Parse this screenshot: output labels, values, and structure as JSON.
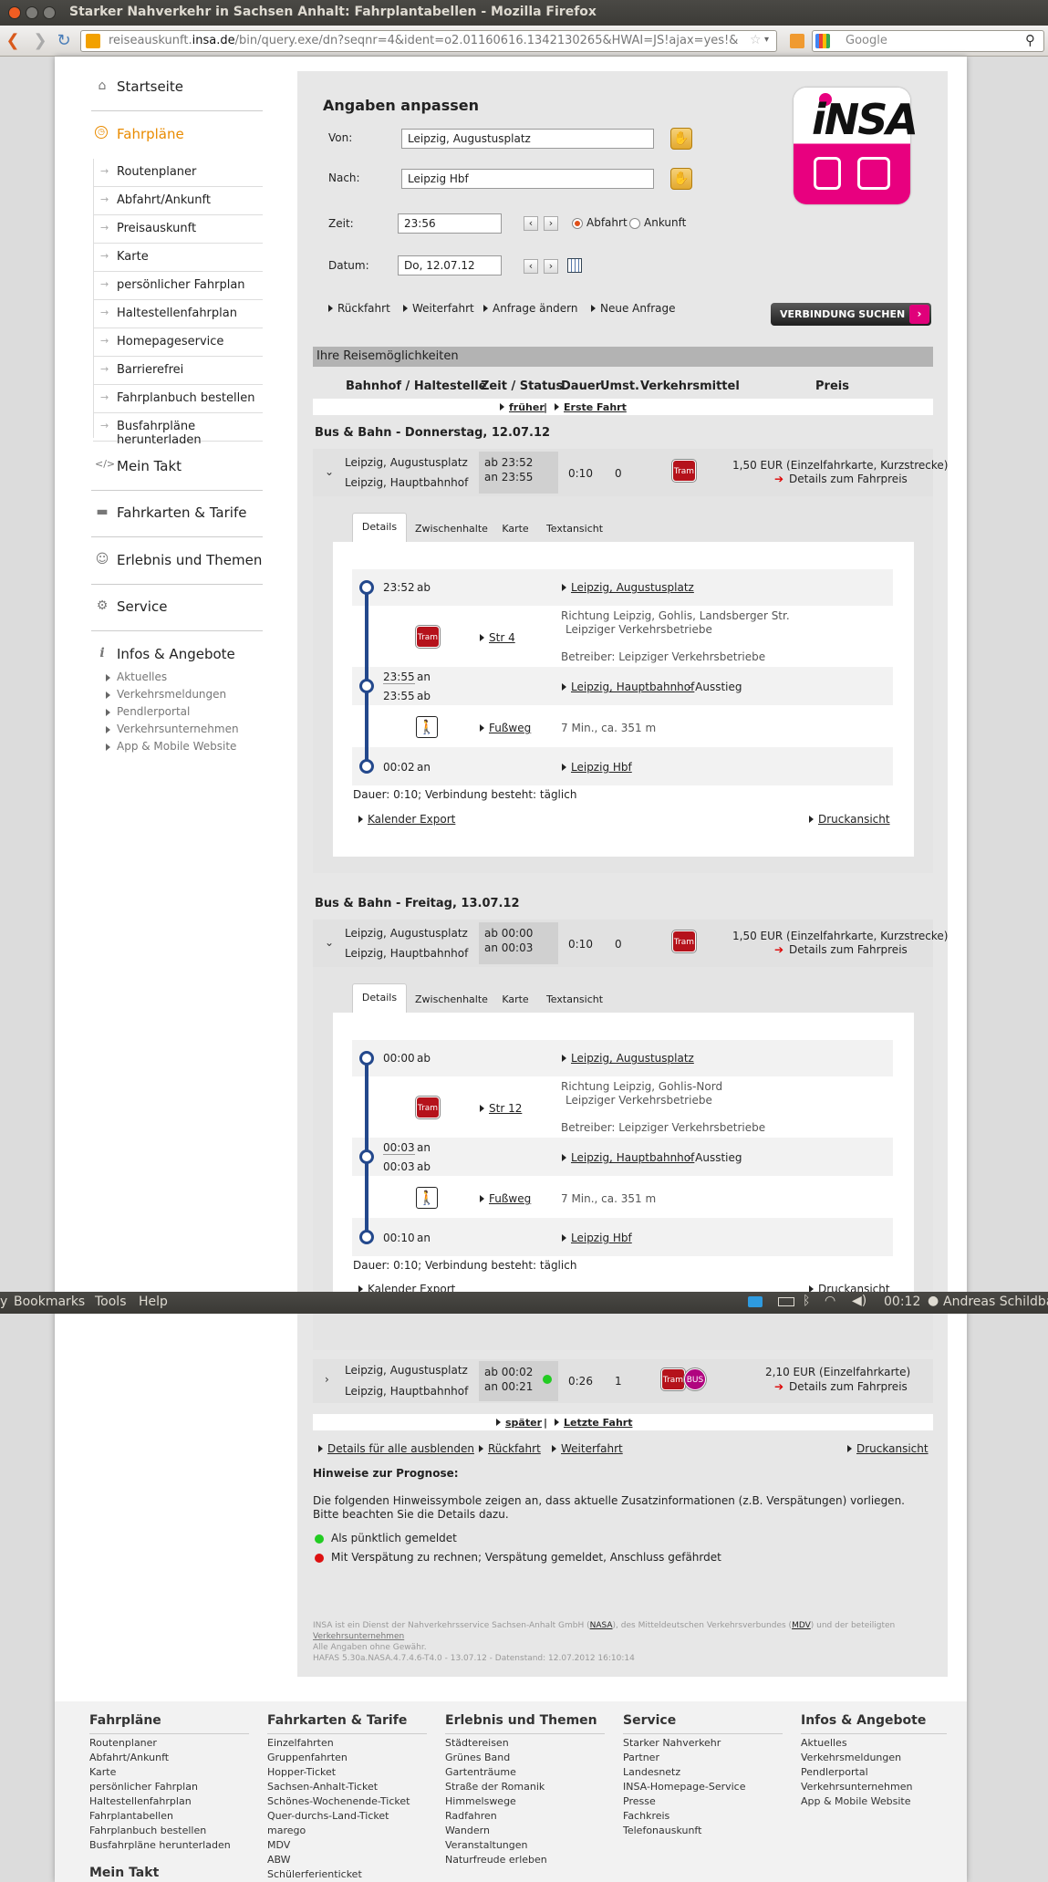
{
  "window": {
    "title": "Starker Nahverkehr in Sachsen Anhalt: Fahrplantabellen - Mozilla Firefox"
  },
  "browser": {
    "url_pre": "reiseauskunft.",
    "url_domain": "insa.de",
    "url_rest": "/bin/query.exe/dn?seqnr=4&ident=o2.01160616.1342130265&HWAI=JS!ajax=yes!&",
    "search_placeholder": "Google"
  },
  "sidebar": {
    "home": "Startseite",
    "fahrplaene": "Fahrpläne",
    "sub": [
      "Routenplaner",
      "Abfahrt/Ankunft",
      "Preisauskunft",
      "Karte",
      "persönlicher Fahrplan",
      "Haltestellenfahrplan",
      "Homepageservice",
      "Barrierefrei",
      "Fahrplanbuch bestellen",
      "Busfahrpläne herunterladen"
    ],
    "mein_takt": "Mein Takt",
    "tarife": "Fahrkarten & Tarife",
    "erlebnis": "Erlebnis und Themen",
    "service": "Service",
    "infos": "Infos & Angebote",
    "infos_sub": [
      "Aktuelles",
      "Verkehrsmeldungen",
      "Pendlerportal",
      "Verkehrsunternehmen",
      "App & Mobile Website"
    ]
  },
  "form": {
    "title": "Angaben anpassen",
    "von_label": "Von:",
    "von_value": "Leipzig, Augustusplatz",
    "nach_label": "Nach:",
    "nach_value": "Leipzig Hbf",
    "zeit_label": "Zeit:",
    "zeit_value": "23:56",
    "datum_label": "Datum:",
    "datum_value": "Do, 12.07.12",
    "abfahrt": "Abfahrt",
    "ankunft": "Ankunft",
    "links": [
      "Rückfahrt",
      "Weiterfahrt",
      "Anfrage ändern",
      "Neue Anfrage"
    ],
    "search_button": "VERBINDUNG SUCHEN"
  },
  "results": {
    "header": "Ihre Reisemöglichkeiten",
    "columns": [
      "Bahnhof / Haltestelle",
      "Zeit / Status",
      "Dauer",
      "Umst.",
      "Verkehrsmittel",
      "Preis"
    ],
    "earlier": "früher",
    "first": "Erste Fahrt",
    "sep": "|",
    "later": "später",
    "last": "Letzte Fahrt",
    "day1": "Bus & Bahn - Donnerstag, 12.07.12",
    "day2": "Bus & Bahn - Freitag, 13.07.12",
    "con1": {
      "from": "Leipzig, Augustusplatz",
      "to": "Leipzig, Hauptbahnhof",
      "dep": "ab 23:52",
      "arr": "an 23:55",
      "dur": "0:10",
      "changes": "0",
      "price": "1,50 EUR (Einzelfahrkarte, Kurzstrecke)",
      "price_link": "Details zum Fahrpreis"
    },
    "con2": {
      "from": "Leipzig, Augustusplatz",
      "to": "Leipzig, Hauptbahnhof",
      "dep": "ab 00:00",
      "arr": "an 00:03",
      "dur": "0:10",
      "changes": "0",
      "price": "1,50 EUR (Einzelfahrkarte, Kurzstrecke)",
      "price_link": "Details zum Fahrpreis"
    },
    "con3": {
      "from": "Leipzig, Augustusplatz",
      "to": "Leipzig, Hauptbahnhof",
      "dep": "ab 00:02",
      "arr": "an 00:21",
      "dur": "0:26",
      "changes": "1",
      "price": "2,10 EUR (Einzelfahrkarte)",
      "price_link": "Details zum Fahrpreis"
    },
    "tabs": [
      "Details",
      "Zwischenhalte",
      "Karte",
      "Textansicht"
    ],
    "tram": "Tram",
    "bus": "BUS",
    "d1": {
      "t1": "23:52",
      "ab": "ab",
      "an": "an",
      "s1": "Leipzig, Augustusplatz",
      "line": "Str 4",
      "dir": "Richtung Leipzig, Gohlis, Landsberger Str.",
      "op": "Leipziger Verkehrsbetriebe",
      "betr": "Betreiber: Leipziger Verkehrsbetriebe",
      "t2a": "23:55",
      "t2b": "23:55",
      "s2": "Leipzig, Hauptbahnhof",
      "aus": "- Ausstieg",
      "walk": "Fußweg",
      "walkinfo": "7 Min., ca. 351 m",
      "t3": "00:02",
      "s3": "Leipzig Hbf",
      "summary": "Dauer: 0:10; Verbindung besteht: täglich",
      "kal": "Kalender Export",
      "druck": "Druckansicht"
    },
    "d2": {
      "t1": "00:00",
      "ab": "ab",
      "an": "an",
      "s1": "Leipzig, Augustusplatz",
      "line": "Str 12",
      "dir": "Richtung Leipzig, Gohlis-Nord",
      "op": "Leipziger Verkehrsbetriebe",
      "betr": "Betreiber: Leipziger Verkehrsbetriebe",
      "t2a": "00:03",
      "t2b": "00:03",
      "s2": "Leipzig, Hauptbahnhof",
      "aus": "- Ausstieg",
      "walk": "Fußweg",
      "walkinfo": "7 Min., ca. 351 m",
      "t3": "00:10",
      "s3": "Leipzig Hbf",
      "summary": "Dauer: 0:10; Verbindung besteht: täglich",
      "kal": "Kalender Export",
      "druck": "Druckansicht"
    },
    "bottom_links": [
      "Details für alle ausblenden",
      "Rückfahrt",
      "Weiterfahrt",
      "Druckansicht"
    ],
    "hint_title": "Hinweise zur Prognose:",
    "hint_text1": "Die folgenden Hinweissymbole zeigen an, dass aktuelle Zusatzinformationen (z.B. Verspätungen) vorliegen.",
    "hint_text2": "Bitte beachten Sie die Details dazu.",
    "legend_green": "Als pünktlich gemeldet",
    "legend_red": "Mit Verspätung zu rechnen; Verspätung gemeldet, Anschluss gefährdet",
    "green": "#22cc22",
    "red": "#dd1111",
    "small1a": "INSA ist ein Dienst der Nahverkehrsservice Sachsen-Anhalt GmbH (",
    "nasa": "NASA",
    "small1b": "), des Mitteldeutschen Verkehrsverbundes (",
    "mdv": "MDV",
    "small1c": ") und der beteiligten",
    "small2": "Verkehrsunternehmen",
    "small3": "Alle Angaben ohne Gewähr.",
    "small4": "HAFAS 5.30a.NASA.4.7.4.6-T4.0 - 13.07.12 - Datenstand: 12.07.2012 16:10:14"
  },
  "ubuntu": {
    "menus": [
      "y",
      "Bookmarks",
      "Tools",
      "Help"
    ],
    "clock": "00:12",
    "user": "Andreas Schildba"
  },
  "footer": {
    "cols": [
      {
        "title": "Fahrpläne",
        "items": [
          "Routenplaner",
          "Abfahrt/Ankunft",
          "Karte",
          "persönlicher Fahrplan",
          "Haltestellenfahrplan",
          "Fahrplantabellen",
          "Fahrplanbuch bestellen",
          "Busfahrpläne herunterladen"
        ]
      },
      {
        "title": "Fahrkarten & Tarife",
        "items": [
          "Einzelfahrten",
          "Gruppenfahrten",
          "Hopper-Ticket",
          "Sachsen-Anhalt-Ticket",
          "Schönes-Wochenende-Ticket",
          "Quer-durchs-Land-Ticket",
          "marego",
          "MDV",
          "ABW",
          "Schülerferienticket"
        ]
      },
      {
        "title": "Erlebnis und Themen",
        "items": [
          "Städtereisen",
          "Grünes Band",
          "Gartenträume",
          "Straße der Romanik",
          "Himmelswege",
          "Radfahren",
          "Wandern",
          "Veranstaltungen",
          "Naturfreude erleben"
        ]
      },
      {
        "title": "Service",
        "items": [
          "Starker Nahverkehr",
          "Partner",
          "Landesnetz",
          "INSA-Homepage-Service",
          "Presse",
          "Fachkreis",
          "Telefonauskunft"
        ]
      },
      {
        "title": "Infos & Angebote",
        "items": [
          "Aktuelles",
          "Verkehrsmeldungen",
          "Pendlerportal",
          "Verkehrsunternehmen",
          "App & Mobile Website"
        ]
      }
    ],
    "mein_takt": "Mein Takt"
  }
}
